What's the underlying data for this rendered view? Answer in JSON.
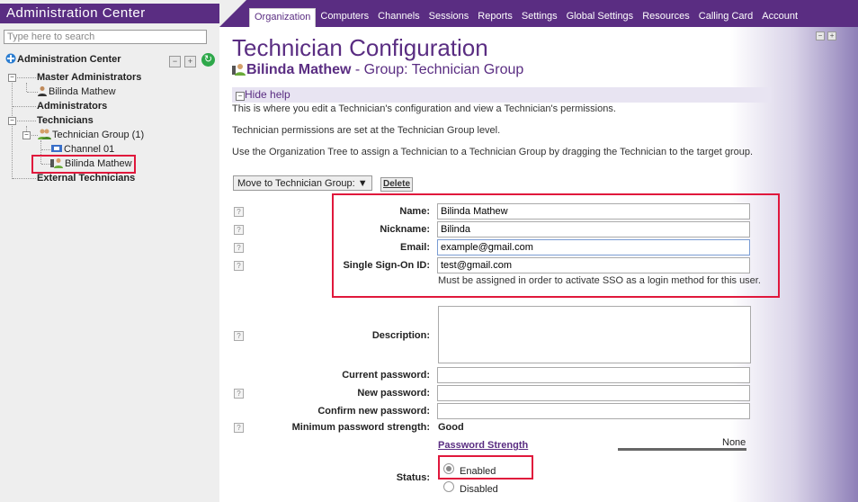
{
  "app": {
    "title": "Administration Center"
  },
  "search": {
    "placeholder": "Type here to search"
  },
  "tree": {
    "root": "Administration Center",
    "master_admins": "Master Administrators",
    "master_admin_user": "Bilinda Mathew",
    "administrators": "Administrators",
    "technicians": "Technicians",
    "technician_group": "Technician Group (1)",
    "channel": "Channel 01",
    "technician_user": "Bilinda Mathew",
    "external_technicians": "External Technicians"
  },
  "nav": {
    "tabs": [
      "Organization",
      "Computers",
      "Channels",
      "Sessions",
      "Reports",
      "Settings",
      "Global Settings",
      "Resources",
      "Calling Card",
      "Account"
    ],
    "active": "Organization"
  },
  "header": {
    "title": "Technician Configuration",
    "user_name": "Bilinda Mathew",
    "group_suffix": " - Group: Technician Group"
  },
  "help": {
    "toggle": "Hide help",
    "line1": "This is where you edit a Technician's configuration and view a Technician's permissions.",
    "line2": "Technician permissions are set at the Technician Group level.",
    "line3": "Use the Organization Tree to assign a Technician to a Technician Group by dragging the Technician to the target group."
  },
  "actions": {
    "move_select": "Move to Technician Group:",
    "delete": "Delete"
  },
  "form": {
    "name_label": "Name:",
    "name_value": "Bilinda Mathew",
    "nickname_label": "Nickname:",
    "nickname_value": "Bilinda",
    "email_label": "Email:",
    "email_value": "example@gmail.com",
    "sso_label": "Single Sign-On ID:",
    "sso_value": "test@gmail.com",
    "sso_note": "Must be assigned in order to activate SSO as a login method for this user.",
    "description_label": "Description:",
    "current_pw_label": "Current password:",
    "new_pw_label": "New password:",
    "confirm_pw_label": "Confirm new password:",
    "min_strength_label": "Minimum password strength:",
    "min_strength_value": "Good",
    "pw_strength_link": "Password Strength",
    "pw_strength_meter": "None",
    "status_label": "Status:",
    "status_enabled": "Enabled",
    "status_disabled": "Disabled",
    "status_selected": "Enabled"
  },
  "colors": {
    "brand": "#5a2d82",
    "highlight": "#e0183c"
  }
}
